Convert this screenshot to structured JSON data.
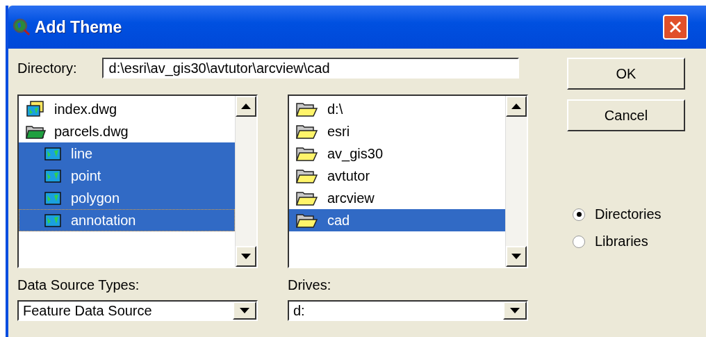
{
  "window": {
    "title": "Add Theme"
  },
  "directory": {
    "label": "Directory:",
    "value": "d:\\esri\\av_gis30\\avtutor\\arcview\\cad"
  },
  "themes": [
    {
      "label": "index.dwg",
      "kind": "drawing",
      "expanded": false,
      "selected": false,
      "focused": false
    },
    {
      "label": "parcels.dwg",
      "kind": "drawing",
      "expanded": true,
      "selected": false,
      "focused": false,
      "children": [
        {
          "label": "line",
          "kind": "feature",
          "selected": true,
          "focused": false
        },
        {
          "label": "point",
          "kind": "feature",
          "selected": true,
          "focused": false
        },
        {
          "label": "polygon",
          "kind": "feature",
          "selected": true,
          "focused": false
        },
        {
          "label": "annotation",
          "kind": "feature",
          "selected": true,
          "focused": true
        }
      ]
    }
  ],
  "folders": [
    {
      "label": "d:\\",
      "selected": false
    },
    {
      "label": "esri",
      "selected": false
    },
    {
      "label": "av_gis30",
      "selected": false
    },
    {
      "label": "avtutor",
      "selected": false
    },
    {
      "label": "arcview",
      "selected": false
    },
    {
      "label": "cad",
      "selected": true
    }
  ],
  "buttons": [
    "OK",
    "Cancel"
  ],
  "source_mode": [
    {
      "label": "Directories",
      "selected": true
    },
    {
      "label": "Libraries",
      "selected": false
    }
  ],
  "data_source_types": {
    "label": "Data Source Types:",
    "value": "Feature Data Source"
  },
  "drives": {
    "label": "Drives:",
    "value": "d:"
  }
}
